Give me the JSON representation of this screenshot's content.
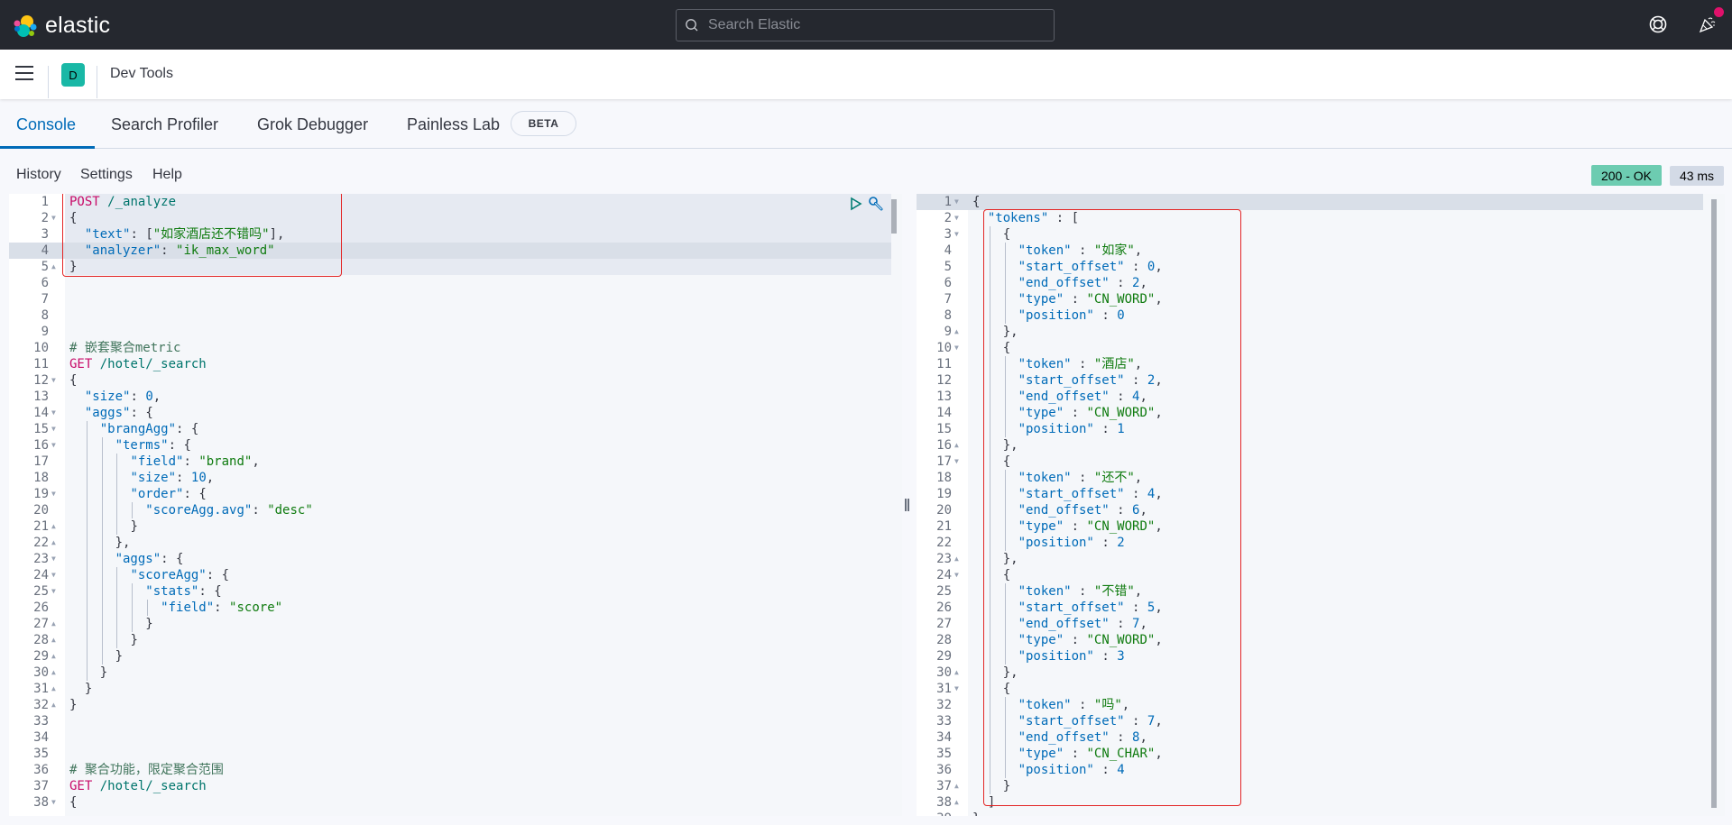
{
  "header": {
    "brand": "elastic",
    "search_placeholder": "Search Elastic",
    "icons": [
      "help-lifebuoy-icon",
      "newsfeed-party-icon"
    ],
    "notification_color": "#e0116b"
  },
  "subheader": {
    "space_initial": "D",
    "space_color": "#19b8a6",
    "breadcrumb": "Dev Tools"
  },
  "tabs": [
    {
      "label": "Console",
      "active": true
    },
    {
      "label": "Search Profiler",
      "active": false
    },
    {
      "label": "Grok Debugger",
      "active": false
    },
    {
      "label": "Painless Lab",
      "active": false,
      "badge": "BETA"
    }
  ],
  "toolbar": {
    "history": "History",
    "settings": "Settings",
    "help": "Help"
  },
  "status": {
    "code": "200 - OK",
    "time": "43 ms",
    "ok_color": "#6dccb1"
  },
  "request_editor": {
    "lines": [
      "POST /_analyze",
      "{",
      "  \"text\": [\"如家酒店还不错吗\"],",
      "  \"analyzer\": \"ik_max_word\"",
      "}",
      "",
      "",
      "",
      "",
      "# 嵌套聚合metric",
      "GET /hotel/_search",
      "{",
      "  \"size\": 0,",
      "  \"aggs\": {",
      "    \"brangAgg\": {",
      "      \"terms\": {",
      "        \"field\": \"brand\",",
      "        \"size\": 10,",
      "        \"order\": {",
      "          \"scoreAgg.avg\": \"desc\"",
      "        }",
      "      },",
      "      \"aggs\": {",
      "        \"scoreAgg\": {",
      "          \"stats\": {",
      "            \"field\": \"score\"",
      "          }",
      "        }",
      "      }",
      "    }",
      "  }",
      "}",
      "",
      "",
      "",
      "# 聚合功能，限定聚合范围",
      "GET /hotel/_search",
      "{"
    ],
    "folds": {
      "2": "down",
      "5": "up",
      "12": "down",
      "14": "down",
      "15": "down",
      "16": "down",
      "19": "down",
      "21": "up",
      "22": "up",
      "23": "down",
      "24": "down",
      "25": "down",
      "27": "up",
      "28": "up",
      "29": "up",
      "30": "up",
      "31": "up",
      "32": "up",
      "38": "down"
    },
    "action_icons": [
      "play-icon",
      "wrench-icon"
    ]
  },
  "response_editor": {
    "lines": [
      "{",
      "  \"tokens\" : [",
      "    {",
      "      \"token\" : \"如家\",",
      "      \"start_offset\" : 0,",
      "      \"end_offset\" : 2,",
      "      \"type\" : \"CN_WORD\",",
      "      \"position\" : 0",
      "    },",
      "    {",
      "      \"token\" : \"酒店\",",
      "      \"start_offset\" : 2,",
      "      \"end_offset\" : 4,",
      "      \"type\" : \"CN_WORD\",",
      "      \"position\" : 1",
      "    },",
      "    {",
      "      \"token\" : \"还不\",",
      "      \"start_offset\" : 4,",
      "      \"end_offset\" : 6,",
      "      \"type\" : \"CN_WORD\",",
      "      \"position\" : 2",
      "    },",
      "    {",
      "      \"token\" : \"不错\",",
      "      \"start_offset\" : 5,",
      "      \"end_offset\" : 7,",
      "      \"type\" : \"CN_WORD\",",
      "      \"position\" : 3",
      "    },",
      "    {",
      "      \"token\" : \"吗\",",
      "      \"start_offset\" : 7,",
      "      \"end_offset\" : 8,",
      "      \"type\" : \"CN_CHAR\",",
      "      \"position\" : 4",
      "    }",
      "  ]",
      "}"
    ],
    "folds": {
      "1": "down",
      "2": "down",
      "3": "down",
      "9": "up",
      "10": "down",
      "16": "up",
      "17": "down",
      "23": "up",
      "24": "down",
      "30": "up",
      "31": "down",
      "37": "up",
      "38": "up"
    }
  }
}
